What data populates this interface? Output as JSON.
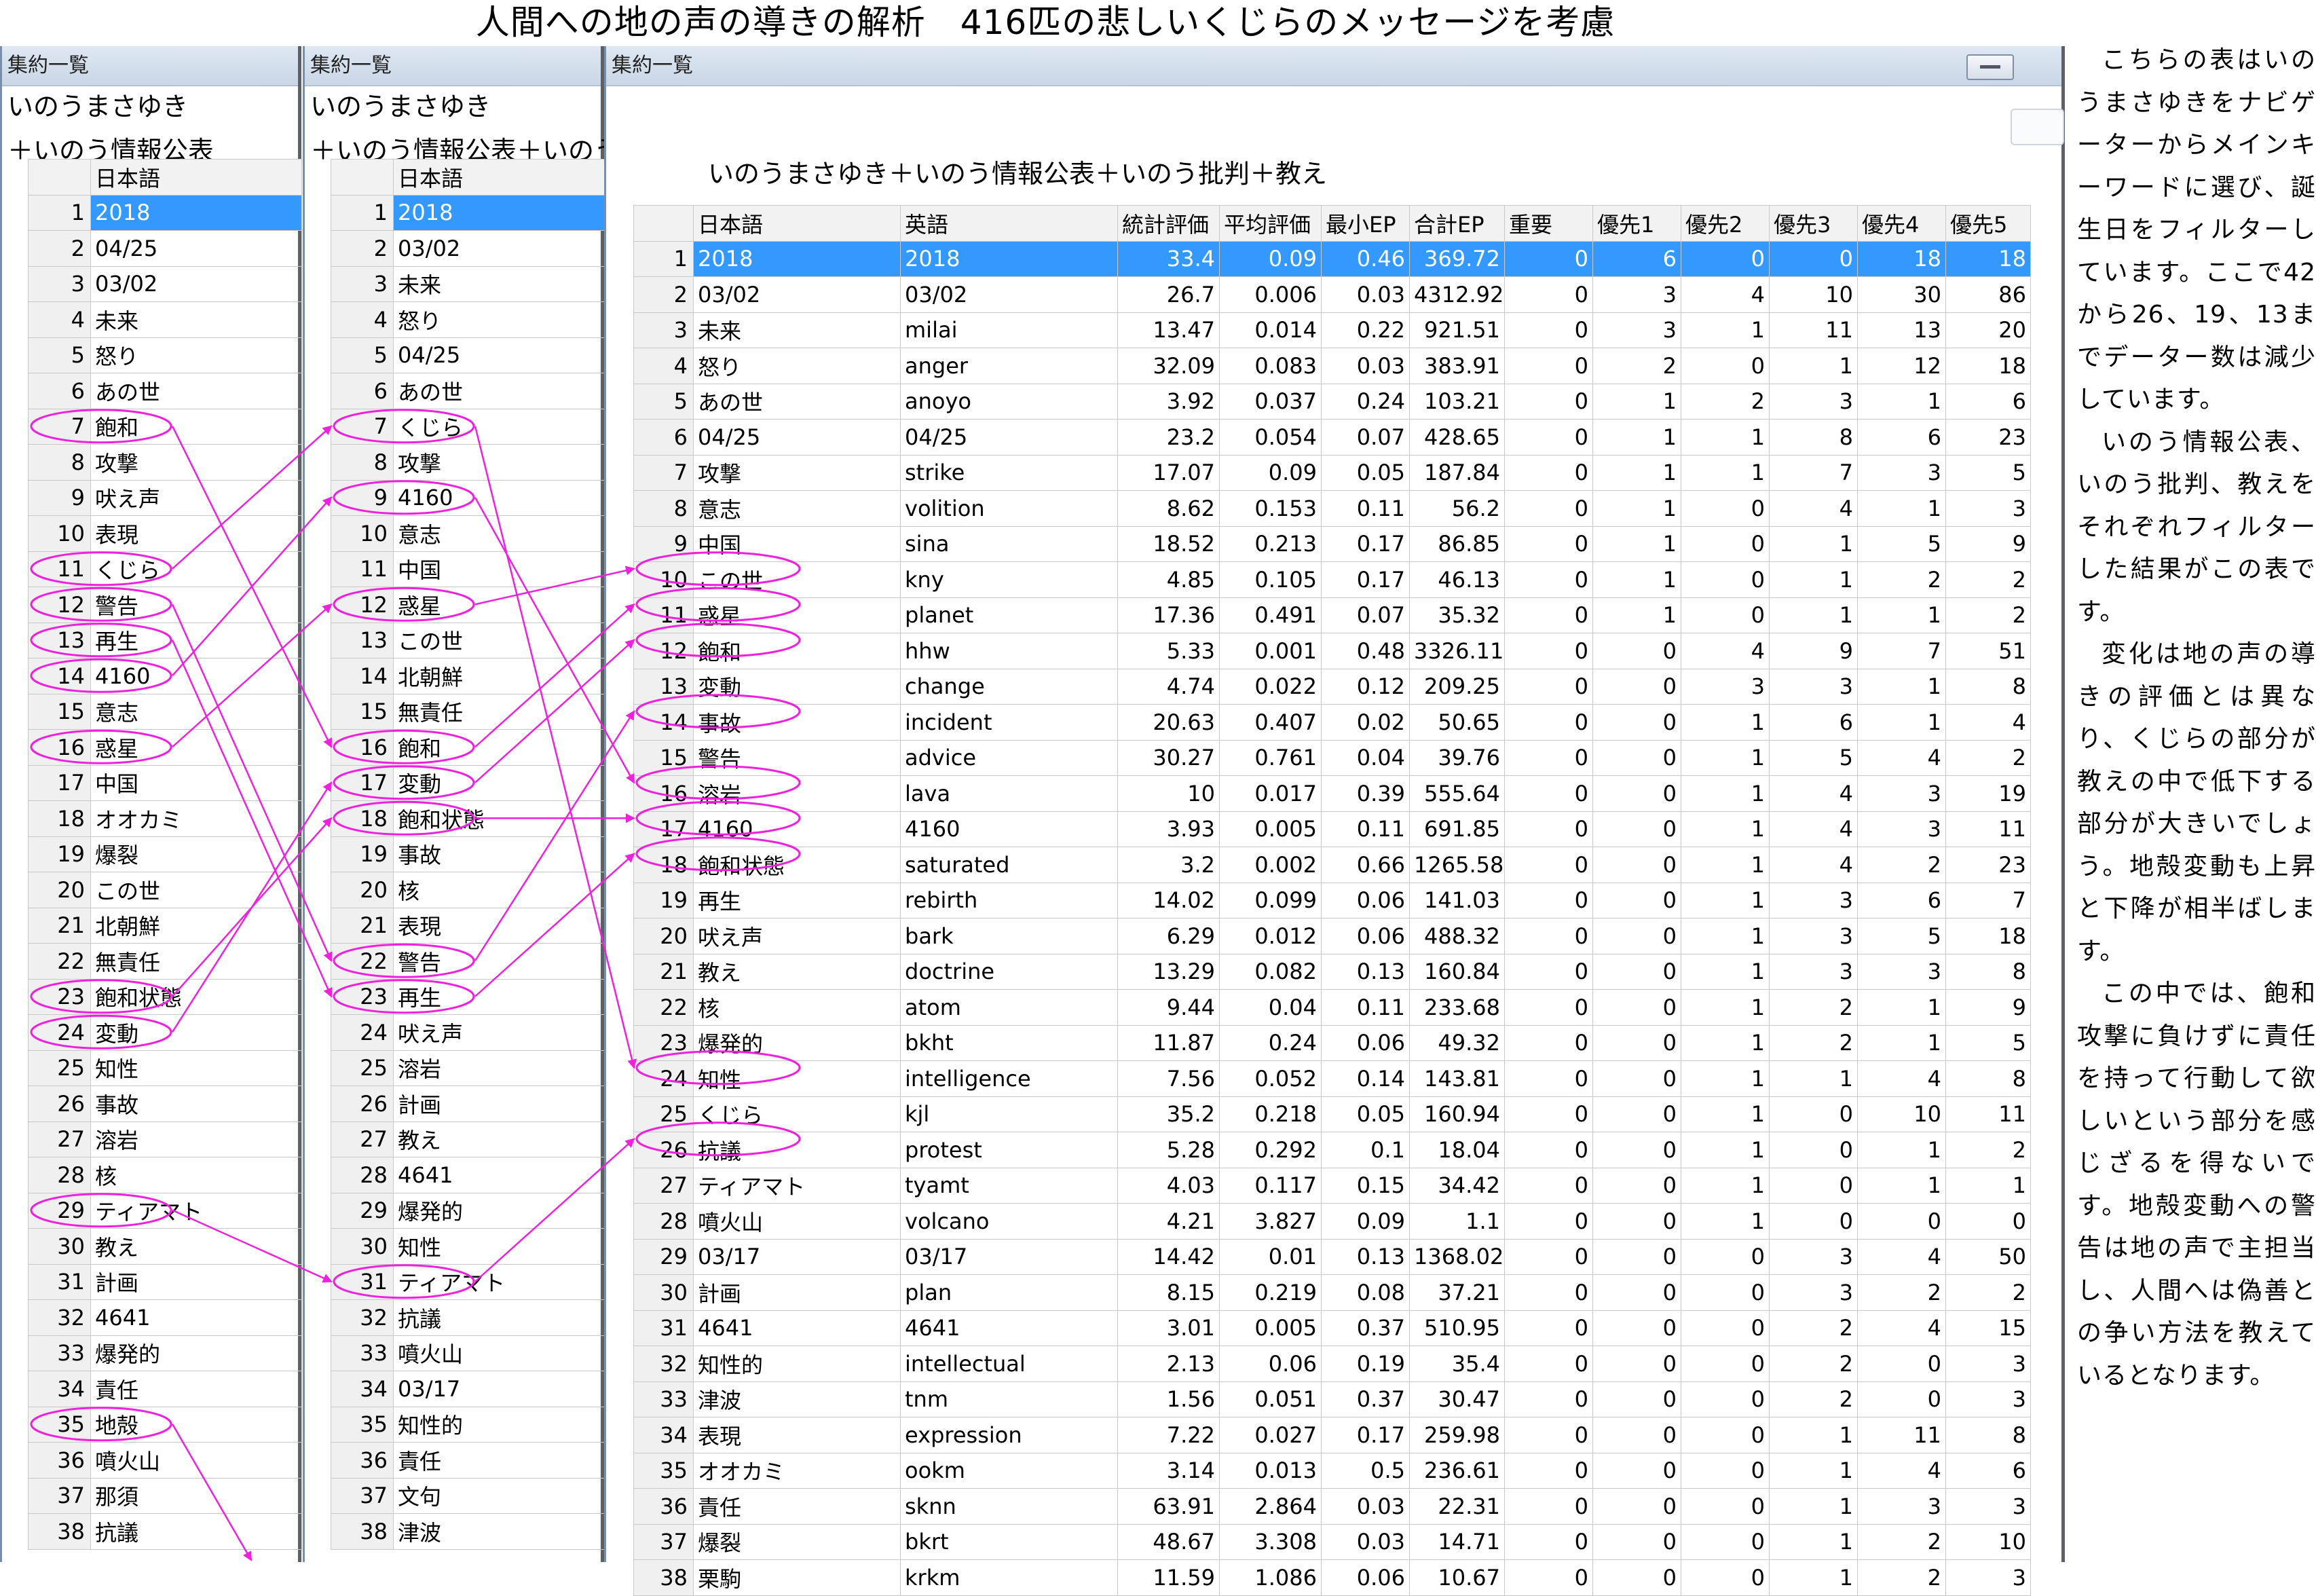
{
  "title": "人間への地の声の導きの解析　416匹の悲しいくじらのメッセージを考慮",
  "panels": [
    {
      "window_title": "集約一覧",
      "caption_line1": "いのうまさゆき",
      "caption_line2": "＋いのう情報公表",
      "header": "日本語",
      "rows": [
        "2018",
        "04/25",
        "03/02",
        "未来",
        "怒り",
        "あの世",
        "飽和",
        "攻撃",
        "吠え声",
        "表現",
        "くじら",
        "警告",
        "再生",
        "4160",
        "意志",
        "惑星",
        "中国",
        "オオカミ",
        "爆裂",
        "この世",
        "北朝鮮",
        "無責任",
        "飽和状態",
        "変動",
        "知性",
        "事故",
        "溶岩",
        "核",
        "ティアマト",
        "教え",
        "計画",
        "4641",
        "爆発的",
        "責任",
        "地殻",
        "噴火山",
        "那須",
        "抗議"
      ]
    },
    {
      "window_title": "集約一覧",
      "caption_line1": "いのうまさゆき",
      "caption_line2": "＋いのう情報公表＋いのう批判",
      "header": "日本語",
      "rows": [
        "2018",
        "03/02",
        "未来",
        "怒り",
        "04/25",
        "あの世",
        "くじら",
        "攻撃",
        "4160",
        "意志",
        "中国",
        "惑星",
        "この世",
        "北朝鮮",
        "無責任",
        "飽和",
        "変動",
        "飽和状態",
        "事故",
        "核",
        "表現",
        "警告",
        "再生",
        "吠え声",
        "溶岩",
        "計画",
        "教え",
        "4641",
        "爆発的",
        "知性",
        "ティアマト",
        "抗議",
        "噴火山",
        "03/17",
        "知性的",
        "責任",
        "文句",
        "津波"
      ]
    }
  ],
  "main": {
    "window_title": "集約一覧",
    "caption": "いのうまさゆき＋いのう情報公表＋いのう批判＋教え",
    "headers": [
      "日本語",
      "英語",
      "統計評価",
      "平均評価",
      "最小EP",
      "合計EP",
      "重要",
      "優先1",
      "優先2",
      "優先3",
      "優先4",
      "優先5"
    ],
    "rows": [
      [
        "2018",
        "2018",
        "33.4",
        "0.09",
        "0.46",
        "369.72",
        "0",
        "6",
        "0",
        "0",
        "18",
        "18"
      ],
      [
        "03/02",
        "03/02",
        "26.7",
        "0.006",
        "0.03",
        "4312.92",
        "0",
        "3",
        "4",
        "10",
        "30",
        "86"
      ],
      [
        "未来",
        "milai",
        "13.47",
        "0.014",
        "0.22",
        "921.51",
        "0",
        "3",
        "1",
        "11",
        "13",
        "20"
      ],
      [
        "怒り",
        "anger",
        "32.09",
        "0.083",
        "0.03",
        "383.91",
        "0",
        "2",
        "0",
        "1",
        "12",
        "18"
      ],
      [
        "あの世",
        "anoyo",
        "3.92",
        "0.037",
        "0.24",
        "103.21",
        "0",
        "1",
        "2",
        "3",
        "1",
        "6"
      ],
      [
        "04/25",
        "04/25",
        "23.2",
        "0.054",
        "0.07",
        "428.65",
        "0",
        "1",
        "1",
        "8",
        "6",
        "23"
      ],
      [
        "攻撃",
        "strike",
        "17.07",
        "0.09",
        "0.05",
        "187.84",
        "0",
        "1",
        "1",
        "7",
        "3",
        "5"
      ],
      [
        "意志",
        "volition",
        "8.62",
        "0.153",
        "0.11",
        "56.2",
        "0",
        "1",
        "0",
        "4",
        "1",
        "3"
      ],
      [
        "中国",
        "sina",
        "18.52",
        "0.213",
        "0.17",
        "86.85",
        "0",
        "1",
        "0",
        "1",
        "5",
        "9"
      ],
      [
        "この世",
        "kny",
        "4.85",
        "0.105",
        "0.17",
        "46.13",
        "0",
        "1",
        "0",
        "1",
        "2",
        "2"
      ],
      [
        "惑星",
        "planet",
        "17.36",
        "0.491",
        "0.07",
        "35.32",
        "0",
        "1",
        "0",
        "1",
        "1",
        "2"
      ],
      [
        "飽和",
        "hhw",
        "5.33",
        "0.001",
        "0.48",
        "3326.11",
        "0",
        "0",
        "4",
        "9",
        "7",
        "51"
      ],
      [
        "変動",
        "change",
        "4.74",
        "0.022",
        "0.12",
        "209.25",
        "0",
        "0",
        "3",
        "3",
        "1",
        "8"
      ],
      [
        "事故",
        "incident",
        "20.63",
        "0.407",
        "0.02",
        "50.65",
        "0",
        "0",
        "1",
        "6",
        "1",
        "4"
      ],
      [
        "警告",
        "advice",
        "30.27",
        "0.761",
        "0.04",
        "39.76",
        "0",
        "0",
        "1",
        "5",
        "4",
        "2"
      ],
      [
        "溶岩",
        "lava",
        "10",
        "0.017",
        "0.39",
        "555.64",
        "0",
        "0",
        "1",
        "4",
        "3",
        "19"
      ],
      [
        "4160",
        "4160",
        "3.93",
        "0.005",
        "0.11",
        "691.85",
        "0",
        "0",
        "1",
        "4",
        "3",
        "11"
      ],
      [
        "飽和状態",
        "saturated",
        "3.2",
        "0.002",
        "0.66",
        "1265.58",
        "0",
        "0",
        "1",
        "4",
        "2",
        "23"
      ],
      [
        "再生",
        "rebirth",
        "14.02",
        "0.099",
        "0.06",
        "141.03",
        "0",
        "0",
        "1",
        "3",
        "6",
        "7"
      ],
      [
        "吠え声",
        "bark",
        "6.29",
        "0.012",
        "0.06",
        "488.32",
        "0",
        "0",
        "1",
        "3",
        "5",
        "18"
      ],
      [
        "教え",
        "doctrine",
        "13.29",
        "0.082",
        "0.13",
        "160.84",
        "0",
        "0",
        "1",
        "3",
        "3",
        "8"
      ],
      [
        "核",
        "atom",
        "9.44",
        "0.04",
        "0.11",
        "233.68",
        "0",
        "0",
        "1",
        "2",
        "1",
        "9"
      ],
      [
        "爆発的",
        "bkht",
        "11.87",
        "0.24",
        "0.06",
        "49.32",
        "0",
        "0",
        "1",
        "2",
        "1",
        "5"
      ],
      [
        "知性",
        "intelligence",
        "7.56",
        "0.052",
        "0.14",
        "143.81",
        "0",
        "0",
        "1",
        "1",
        "4",
        "8"
      ],
      [
        "くじら",
        "kjl",
        "35.2",
        "0.218",
        "0.05",
        "160.94",
        "0",
        "0",
        "1",
        "0",
        "10",
        "11"
      ],
      [
        "抗議",
        "protest",
        "5.28",
        "0.292",
        "0.1",
        "18.04",
        "0",
        "0",
        "1",
        "0",
        "1",
        "2"
      ],
      [
        "ティアマト",
        "tyamt",
        "4.03",
        "0.117",
        "0.15",
        "34.42",
        "0",
        "0",
        "1",
        "0",
        "1",
        "1"
      ],
      [
        "噴火山",
        "volcano",
        "4.21",
        "3.827",
        "0.09",
        "1.1",
        "0",
        "0",
        "1",
        "0",
        "0",
        "0"
      ],
      [
        "03/17",
        "03/17",
        "14.42",
        "0.01",
        "0.13",
        "1368.02",
        "0",
        "0",
        "0",
        "3",
        "4",
        "50"
      ],
      [
        "計画",
        "plan",
        "8.15",
        "0.219",
        "0.08",
        "37.21",
        "0",
        "0",
        "0",
        "3",
        "2",
        "2"
      ],
      [
        "4641",
        "4641",
        "3.01",
        "0.005",
        "0.37",
        "510.95",
        "0",
        "0",
        "0",
        "2",
        "4",
        "15"
      ],
      [
        "知性的",
        "intellectual",
        "2.13",
        "0.06",
        "0.19",
        "35.4",
        "0",
        "0",
        "0",
        "2",
        "0",
        "3"
      ],
      [
        "津波",
        "tnm",
        "1.56",
        "0.051",
        "0.37",
        "30.47",
        "0",
        "0",
        "0",
        "2",
        "0",
        "3"
      ],
      [
        "表現",
        "expression",
        "7.22",
        "0.027",
        "0.17",
        "259.98",
        "0",
        "0",
        "0",
        "1",
        "11",
        "8"
      ],
      [
        "オオカミ",
        "ookm",
        "3.14",
        "0.013",
        "0.5",
        "236.61",
        "0",
        "0",
        "0",
        "1",
        "4",
        "6"
      ],
      [
        "責任",
        "sknn",
        "63.91",
        "2.864",
        "0.03",
        "22.31",
        "0",
        "0",
        "0",
        "1",
        "3",
        "3"
      ],
      [
        "爆裂",
        "bkrt",
        "48.67",
        "3.308",
        "0.03",
        "14.71",
        "0",
        "0",
        "0",
        "1",
        "2",
        "10"
      ],
      [
        "栗駒",
        "krkm",
        "11.59",
        "1.086",
        "0.06",
        "10.67",
        "0",
        "0",
        "0",
        "1",
        "2",
        "3"
      ]
    ]
  },
  "note_paragraphs": [
    "こちらの表はいのうまさゆきをナビゲーターからメインキーワードに選び、誕生日をフィルターしています。ここで42から26、19、13までデーター数は減少しています。",
    "いのう情報公表、いのう批判、教えをそれぞれフィルターした結果がこの表です。",
    "変化は地の声の導きの評価とは異なり、くじらの部分が教えの中で低下する部分が大きいでしょう。地殻変動も上昇と下降が相半ばします。",
    "この中では、飽和攻撃に負けずに責任を持って行動して欲しいという部分を感じざるを得ないです。地殻変動への警告は地の声で主担当し、人間へは偽善との争い方法を教えているとなります。"
  ],
  "annotations": {
    "color": "#ee22dd",
    "circled_panel1": [
      7,
      11,
      12,
      13,
      14,
      16,
      23,
      24,
      29,
      35
    ],
    "circled_panel2": [
      7,
      9,
      12,
      16,
      17,
      18,
      22,
      23,
      31
    ],
    "circled_main": [
      11,
      12,
      13,
      15,
      17,
      18,
      19,
      25,
      27
    ],
    "arrows": [
      {
        "from": "p1-7",
        "to": "p2-16"
      },
      {
        "from": "p1-11",
        "to": "p2-7"
      },
      {
        "from": "p1-12",
        "to": "p2-22"
      },
      {
        "from": "p1-13",
        "to": "p2-23"
      },
      {
        "from": "p1-14",
        "to": "p2-9"
      },
      {
        "from": "p1-16",
        "to": "p2-12"
      },
      {
        "from": "p1-23",
        "to": "p2-18"
      },
      {
        "from": "p1-24",
        "to": "p2-17"
      },
      {
        "from": "p1-29",
        "to": "p2-31"
      },
      {
        "from": "p1-35",
        "to": "off-bottom"
      },
      {
        "from": "p2-7",
        "to": "m-25"
      },
      {
        "from": "p2-9",
        "to": "m-17"
      },
      {
        "from": "p2-12",
        "to": "m-11"
      },
      {
        "from": "p2-16",
        "to": "m-12"
      },
      {
        "from": "p2-17",
        "to": "m-13"
      },
      {
        "from": "p2-18",
        "to": "m-18"
      },
      {
        "from": "p2-22",
        "to": "m-15"
      },
      {
        "from": "p2-23",
        "to": "m-19"
      },
      {
        "from": "p2-31",
        "to": "m-27"
      }
    ]
  }
}
